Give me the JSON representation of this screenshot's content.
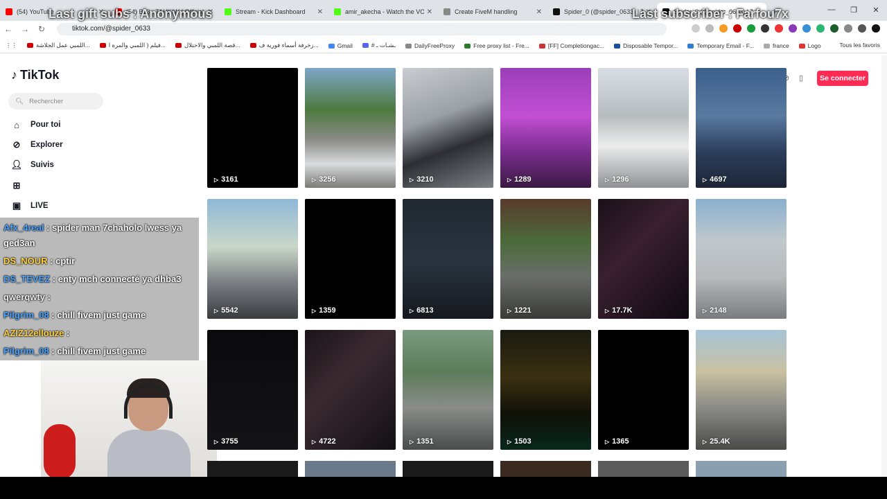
{
  "tabs": [
    {
      "title": "(54) YouTube",
      "color": "#ff0000"
    },
    {
      "title": "(54) Ba3 - TAHKIW ( Official Au...",
      "color": "#ff0000"
    },
    {
      "title": "Stream - Kick Dashboard",
      "color": "#53fc18"
    },
    {
      "title": "amir_akecha - Watch the VOD",
      "color": "#53fc18"
    },
    {
      "title": "Create FiveM handling",
      "color": "#888888"
    },
    {
      "title": "Spider_0 (@spider_0633) | TikTok",
      "color": "#111111"
    },
    {
      "title": "Spider_0 (@spider_0633) | TikTok",
      "color": "#111111",
      "active": true
    }
  ],
  "url": "tiktok.com/@spider_0633",
  "bookmarks": [
    "اللمبي عمل الجلاشة...",
    "فيلم ( اللمبي والمرة ا...",
    "قصة اللمبي والاحتلال...",
    "زخرفة أسماء فورية ف...",
    "Gmail",
    "# ـشـات ـ",
    "DailyFreeProxy",
    "Free proxy list - Fre...",
    "[FF] Completiongac...",
    "Disposable Tempor...",
    "Temporary Email - F...",
    "france",
    "Logo"
  ],
  "bookmarks_all": "Tous les favoris",
  "overlay": {
    "gift": "Last gift subs : Anonymous",
    "sub": "Last subscriber : Farfou7x"
  },
  "sidebar": {
    "logo": "TikTok",
    "search_placeholder": "Rechercher",
    "items": [
      {
        "label": "Pour toi"
      },
      {
        "label": "Explorer"
      },
      {
        "label": "Suivis"
      },
      {
        "label": "LIVE"
      }
    ]
  },
  "chat": [
    {
      "user": "Afx_4real",
      "text": " : spider man 7chaholo lwess ya ged3an",
      "color": "blue"
    },
    {
      "user": "DS_NOUR",
      "text": " : cptir",
      "color": "yellow"
    },
    {
      "user": "DS_TEVEZ",
      "text": " : enty mch connecté ya dhba3",
      "color": "blue"
    },
    {
      "user": "qwerqwty",
      "text": " : ",
      "color": "plain"
    },
    {
      "user": "Pilgrim_08",
      "text": " : chill fivem just game",
      "color": "blue"
    },
    {
      "user": "AZIZ12ellouze",
      "text": " : ",
      "color": "yellow"
    },
    {
      "user": "Pilgrim_08",
      "text": " : chill fivem just game",
      "color": "blue"
    }
  ],
  "header": {
    "login": "Se connecter"
  },
  "videos": [
    {
      "views": "3161",
      "bg": "#000000"
    },
    {
      "views": "3256",
      "bg": "linear-gradient(180deg,#7ea7c8 0%,#4d7a3e 35%,#8b8b88 60%,#d9dcdd 80%,#7b7b78 100%)"
    },
    {
      "views": "3210",
      "bg": "linear-gradient(160deg,#c9ccd0 0%,#9aa0a6 40%,#2c2e33 65%,#7d8087 100%)"
    },
    {
      "views": "1289",
      "bg": "linear-gradient(180deg,#9a3fb8 0%,#c24fd4 40%,#7a2c8e 70%,#3a1a42 100%)"
    },
    {
      "views": "1296",
      "bg": "linear-gradient(180deg,#d8dee4 0%,#b7bcbf 40%,#ecedec 65%,#8f9295 100%)"
    },
    {
      "views": "4697",
      "bg": "linear-gradient(180deg,#3b5f8c 0%,#5a7aa0 40%,#2c3e5c 70%,#1c2536 100%)"
    },
    {
      "views": "5542",
      "bg": "linear-gradient(180deg,#8fb8d8 0%,#c9d7c8 40%,#7a7d82 70%,#3a3c40 100%)"
    },
    {
      "views": "1359",
      "bg": "#000000"
    },
    {
      "views": "6813",
      "bg": "linear-gradient(180deg,#202830 0%,#2a3440 50%,#15191e 100%)"
    },
    {
      "views": "1221",
      "bg": "linear-gradient(180deg,#5a3a2c 0%,#4a6a3a 35%,#6a6e6a 65%,#3a3a38 100%)"
    },
    {
      "views": "17.7K",
      "bg": "linear-gradient(135deg,#1a1018 0%,#3a2030 40%,#0e0a10 100%)"
    },
    {
      "views": "2148",
      "bg": "linear-gradient(180deg,#8ab0d0 0%,#c0c8cc 35%,#b8babc 65%,#7a7c80 100%)"
    },
    {
      "views": "3755",
      "bg": "linear-gradient(180deg,#0a0a0c 0%,#141418 100%)"
    },
    {
      "views": "4722",
      "bg": "linear-gradient(135deg,#1a1418 0%,#3a2a30 40%,#121014 100%)"
    },
    {
      "views": "1351",
      "bg": "linear-gradient(180deg,#7a9a80 0%,#5c7c5a 35%,#8a8c8a 65%,#4a4c4c 100%)"
    },
    {
      "views": "1503",
      "bg": "linear-gradient(180deg,#1a1a10 0%,#3a3010 40%,#101008 70%,#08281c 100%)"
    },
    {
      "views": "1365",
      "bg": "#000000"
    },
    {
      "views": "25.4K",
      "bg": "linear-gradient(180deg,#a8c4d8 0%,#c8c0a0 35%,#8a8a86 65%,#4a4a48 100%)"
    }
  ]
}
